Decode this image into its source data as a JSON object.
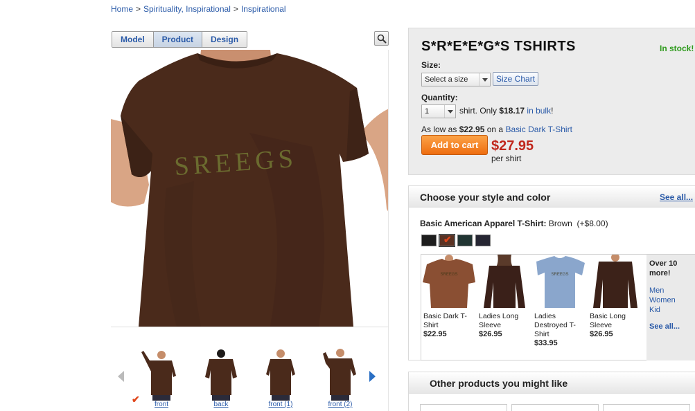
{
  "breadcrumb": [
    {
      "label": "Home"
    },
    {
      "label": "Spirituality, Inspirational"
    },
    {
      "label": "Inspirational"
    }
  ],
  "breadcrumb_sep": ">",
  "view_tabs": [
    {
      "label": "Model",
      "active": false
    },
    {
      "label": "Product",
      "active": true
    },
    {
      "label": "Design",
      "active": false
    }
  ],
  "shirt_print_text": "SREEGS",
  "thumbnails": [
    {
      "caption": "front",
      "selected": true
    },
    {
      "caption": "back",
      "selected": false
    },
    {
      "caption": "front (1)",
      "selected": false
    },
    {
      "caption": "front (2)",
      "selected": false
    }
  ],
  "product": {
    "title": "S*R*E*E*G*S TSHIRTS",
    "stock": "In stock!",
    "size_label": "Size:",
    "size_select": "Select a size",
    "size_chart": "Size Chart",
    "quantity_label": "Quantity:",
    "quantity_value": "1",
    "bulk_pre": "shirt.  Only",
    "bulk_price": "$18.17",
    "bulk_link": "in bulk",
    "bulk_post": "!",
    "low_pre": "As low as",
    "low_price": "$22.95",
    "low_mid": "on a",
    "low_link": "Basic Dark T-Shirt",
    "add_to_cart": "Add to cart",
    "price": "$27.95",
    "per": "per shirt"
  },
  "style": {
    "header": "Choose your style and color",
    "see_all": "See all...",
    "current_name": "Basic American Apparel T-Shirt:",
    "current_color": "Brown",
    "current_extra": "(+$8.00)",
    "swatches": [
      {
        "color": "#1d1d1d",
        "selected": false
      },
      {
        "color": "#5a3223",
        "selected": true
      },
      {
        "color": "#213533",
        "selected": false
      },
      {
        "color": "#262633",
        "selected": false
      }
    ],
    "items": [
      {
        "name": "Basic Dark T-Shirt",
        "price": "$22.95",
        "color": "#8a4f33"
      },
      {
        "name": "Ladies Long Sleeve",
        "price": "$26.95",
        "color": "#3a2019"
      },
      {
        "name": "Ladies Destroyed T-Shirt",
        "price": "$33.95",
        "color": "#8aa6cc"
      },
      {
        "name": "Basic Long Sleeve",
        "price": "$26.95",
        "color": "#3c2219"
      }
    ],
    "more_title": "Over 10 more!",
    "more_links": [
      "Men",
      "Women",
      "Kid"
    ],
    "more_see_all": "See all..."
  },
  "other": {
    "header": "Other products you might like"
  },
  "colors": {
    "link": "#2a5aa8",
    "price": "#c0271c",
    "stock": "#2e9a1c",
    "cta": "#ee6d10",
    "shirt": "#4a2a1b"
  }
}
